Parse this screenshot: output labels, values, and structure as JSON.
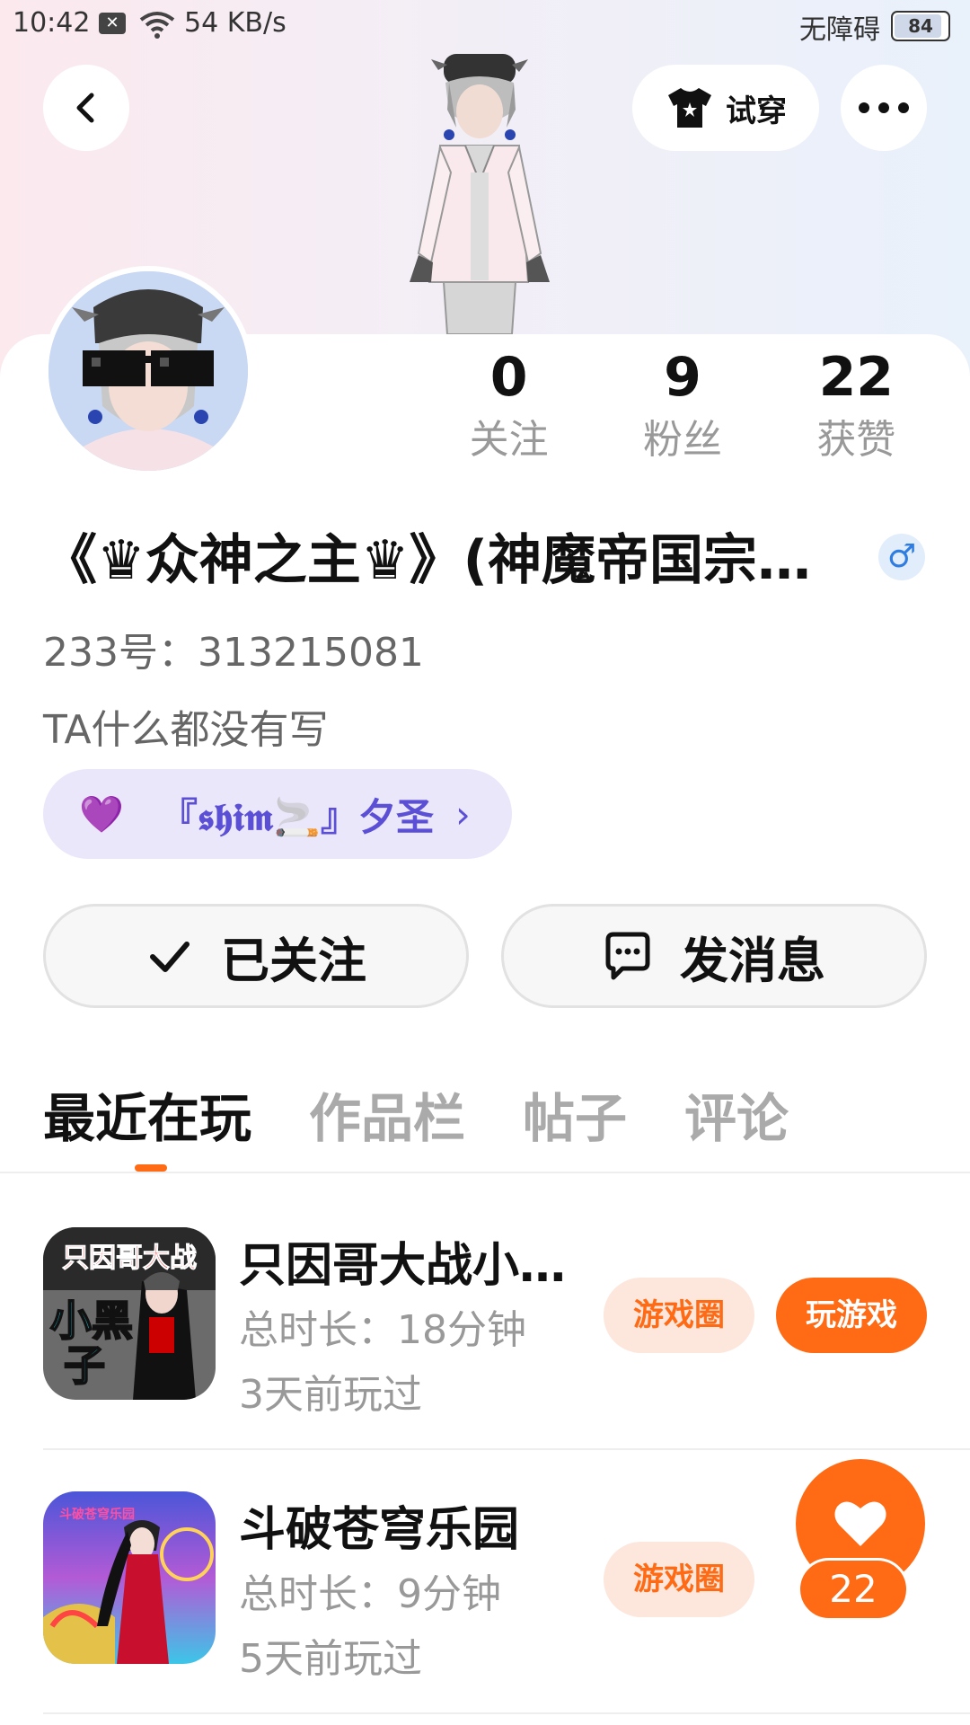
{
  "status_bar": {
    "time": "10:42",
    "network_speed": "54 KB/s",
    "accessibility": "无障碍",
    "battery": "84"
  },
  "header": {
    "tryon_label": "试穿"
  },
  "profile": {
    "stats": [
      {
        "value": "0",
        "label": "关注"
      },
      {
        "value": "9",
        "label": "粉丝"
      },
      {
        "value": "22",
        "label": "获赞"
      }
    ],
    "nickname": "《♛众神之主♛》(神魔帝国宗…",
    "gender_symbol": "♂",
    "uid": "233号：313215081",
    "bio": "TA什么都没有写",
    "cp_tag": "『𝖘𝖍𝖎𝖒🚬』夕圣"
  },
  "actions": {
    "follow_label": "已关注",
    "message_label": "发消息"
  },
  "tabs": [
    {
      "label": "最近在玩",
      "active": true
    },
    {
      "label": "作品栏",
      "active": false
    },
    {
      "label": "帖子",
      "active": false
    },
    {
      "label": "评论",
      "active": false
    }
  ],
  "games": [
    {
      "title": "只因哥大战小…",
      "duration": "总时长：18分钟",
      "last_played": "3天前玩过",
      "icon_text_top": "只因哥大战",
      "icon_text_main": "小黑子",
      "circle_label": "游戏圈",
      "play_label": "玩游戏"
    },
    {
      "title": "斗破苍穹乐园",
      "duration": "总时长：9分钟",
      "last_played": "5天前玩过",
      "icon_text_top": "斗破苍穹乐园",
      "circle_label": "游戏圈"
    }
  ],
  "like_float": {
    "count": "22"
  },
  "colors": {
    "accent": "#ff6a14",
    "cp_purple": "#5b4fd6"
  }
}
